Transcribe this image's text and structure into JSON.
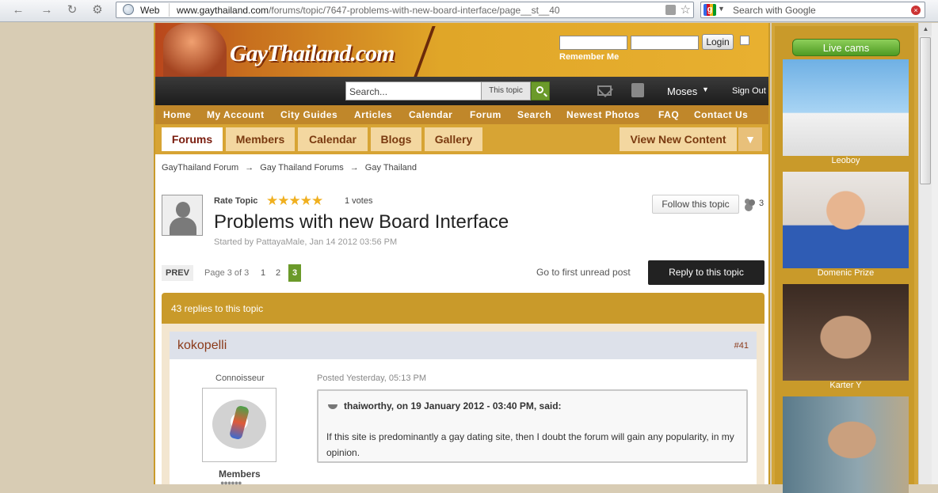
{
  "browser": {
    "web_label": "Web",
    "url_domain": "www.gaythailand.com",
    "url_path": "/forums/topic/7647-problems-with-new-board-interface/page__st__40",
    "search_placeholder": "Search with Google"
  },
  "header": {
    "logo": "GayThailand.com",
    "login_button": "Login",
    "remember_me": "Remember Me"
  },
  "userbar": {
    "search_placeholder": "Search...",
    "search_scope": "This topic",
    "user_name": "Moses",
    "sign_out": "Sign Out"
  },
  "main_nav": [
    "Home",
    "My Account",
    "City Guides",
    "Articles",
    "Calendar",
    "Forum",
    "Search",
    "Newest Photos",
    "FAQ",
    "Contact Us"
  ],
  "tabs": [
    "Forums",
    "Members",
    "Calendar",
    "Blogs",
    "Gallery"
  ],
  "view_new_content": "View New Content",
  "breadcrumb": [
    "GayThailand Forum",
    "Gay Thailand Forums",
    "Gay Thailand"
  ],
  "breadcrumb_sep": "→",
  "topic": {
    "rate_label": "Rate Topic",
    "rating": 5,
    "votes": "1 votes",
    "title": "Problems with new Board Interface",
    "started": "Started by PattayaMale, Jan 14 2012 03:56 PM",
    "follow_button": "Follow this topic",
    "followers": "3"
  },
  "pagination": {
    "prev": "PREV",
    "info": "Page 3 of 3",
    "pages": [
      "1",
      "2",
      "3"
    ],
    "first_unread": "Go to first unread post",
    "reply_button": "Reply to this topic"
  },
  "replies_header": "43 replies to this topic",
  "post": {
    "author": "kokopelli",
    "number": "#41",
    "author_title": "Connoisseur",
    "author_group": "Members",
    "author_pips": "●●●●●●",
    "posted": "Posted Yesterday, 05:13 PM",
    "quote_cite": "thaiworthy, on 19 January 2012 - 03:40 PM, said:",
    "quote_text": "If this site is predominantly a gay dating site, then I doubt the forum will gain any popularity, in my opinion."
  },
  "sidebar": {
    "live_cams": "Live cams",
    "cams": [
      {
        "name": "Leoboy"
      },
      {
        "name": "Domenic Prize"
      },
      {
        "name": "Karter Y"
      },
      {
        "name": ""
      }
    ]
  },
  "colors": {
    "gold": "#c99a2a",
    "tab_bg": "#f3d7a0",
    "accent_green": "#6b9a2a",
    "dark_bar": "#222222"
  }
}
